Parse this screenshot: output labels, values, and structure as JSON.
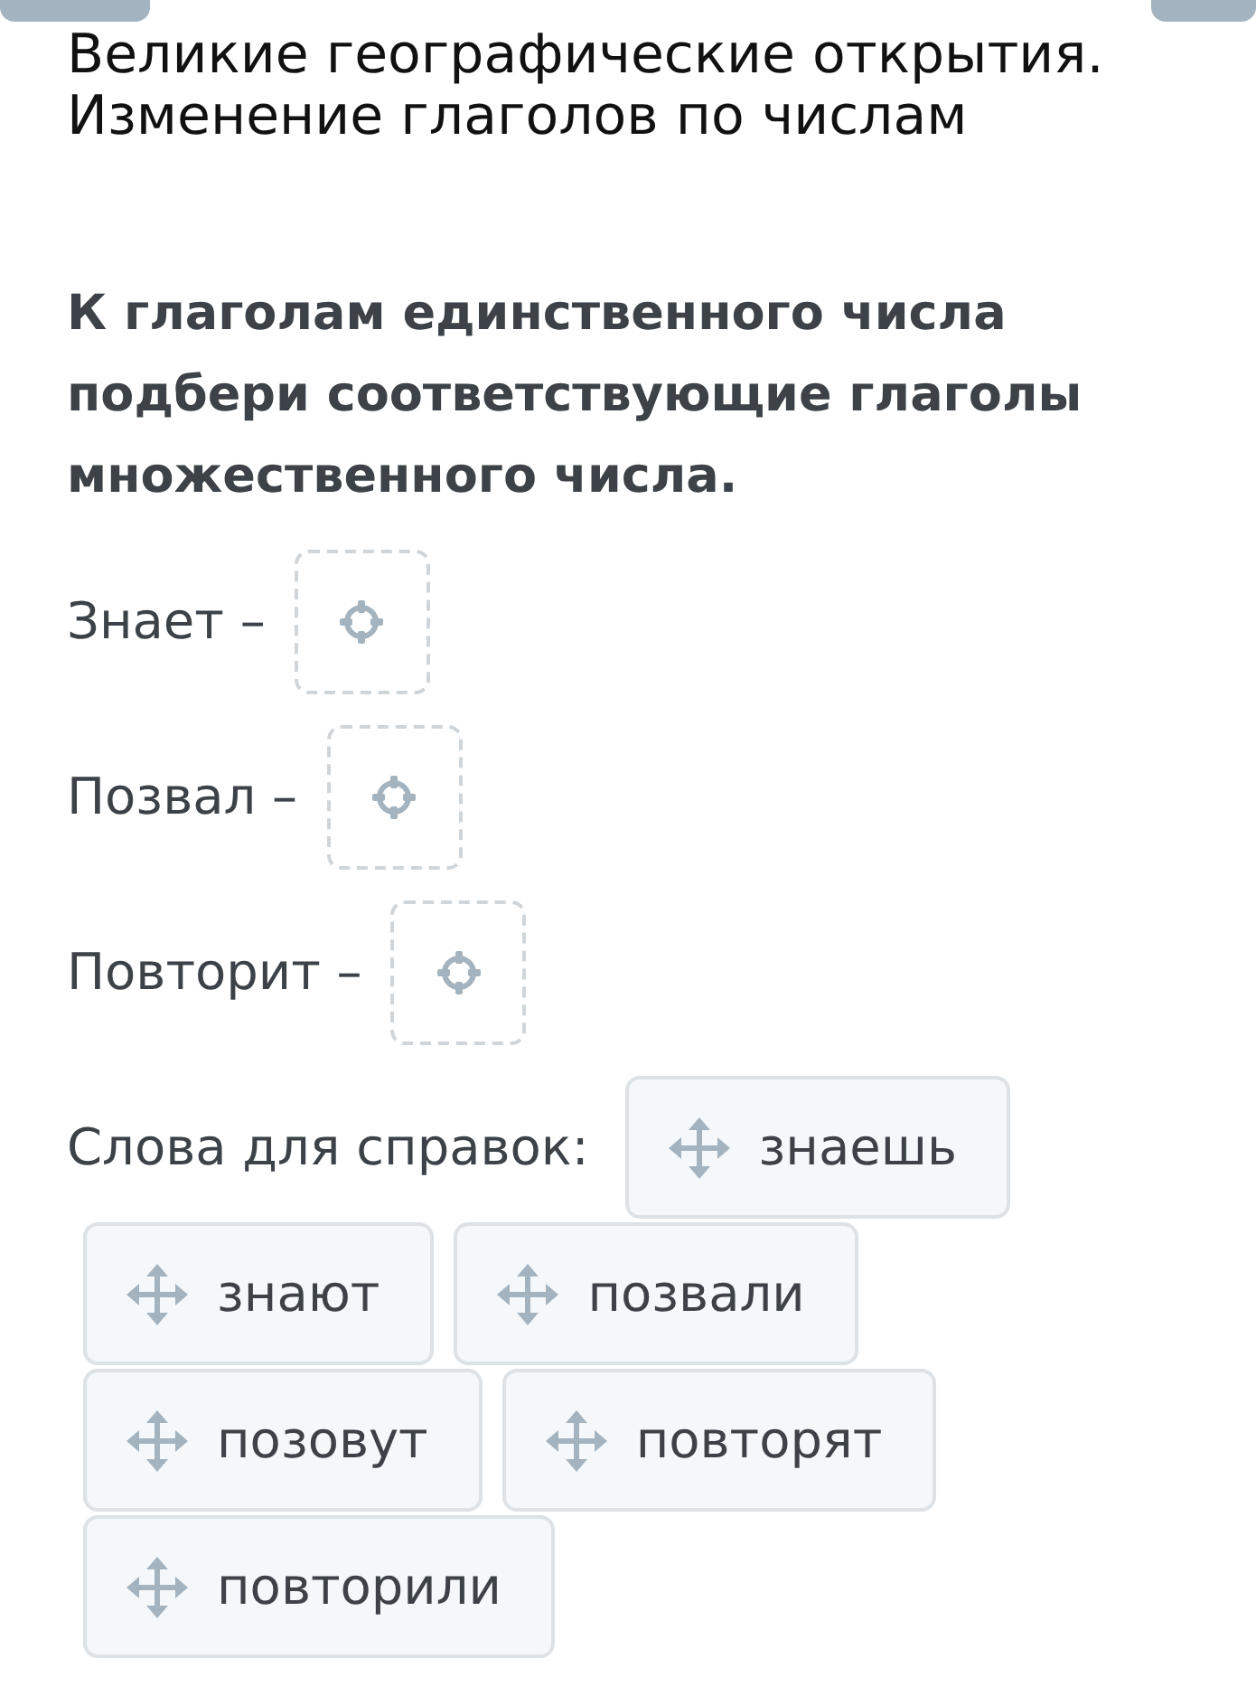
{
  "title": "Великие географические открытия. Изменение глаголов по числам",
  "instruction": "К глаголам единственного числа подбери соответствующие глаголы множественного числа.",
  "items": [
    {
      "prompt": "Знает –"
    },
    {
      "prompt": "Позвал –"
    },
    {
      "prompt": "Повторит –"
    }
  ],
  "word_bank_label": "Слова для справок:",
  "words": [
    "знаешь",
    "знают",
    "позвали",
    "позовут",
    "повторят",
    "повторили"
  ]
}
